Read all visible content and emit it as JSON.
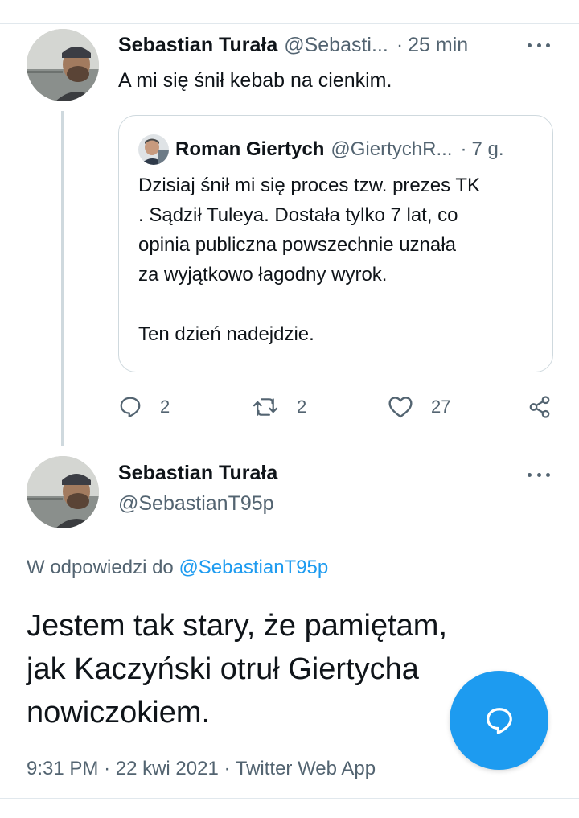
{
  "colors": {
    "accent": "#1d9bf0",
    "text_primary": "#0f1419",
    "text_secondary": "#536471",
    "border": "#cfd9de"
  },
  "tweet1": {
    "author_name": "Sebastian Turała",
    "author_handle": "@Sebasti...",
    "separator": "·",
    "time": "25 min",
    "text": "A mi się śnił kebab na cienkim.",
    "quoted": {
      "author_name": "Roman Giertych",
      "author_handle": "@GiertychR...",
      "separator": "·",
      "time": "7 g.",
      "text_lines": [
        "Dzisiaj śnił mi się proces tzw. prezes TK",
        ". Sądził Tuleya. Dostała tylko 7 lat, co",
        "opinia publiczna powszechnie uznała",
        "za wyjątkowo łagodny wyrok."
      ],
      "text_closing": "Ten dzień nadejdzie."
    },
    "actions": {
      "replies": "2",
      "retweets": "2",
      "likes": "27"
    }
  },
  "tweet2": {
    "author_name": "Sebastian Turała",
    "author_handle": "@SebastianT95p",
    "reply_to_prefix": "W odpowiedzi do",
    "reply_to_handle": "@SebastianT95p",
    "text_lines": [
      "Jestem tak stary, że pamiętam,",
      "jak Kaczyński otruł Giertycha",
      "nowiczokiem."
    ],
    "time": "9:31 PM",
    "separator": "·",
    "date": "22 kwi 2021",
    "source": "Twitter Web App"
  },
  "icons": {
    "more": "more-horizontal-icon",
    "reply": "reply-bubble-icon",
    "retweet": "retweet-icon",
    "like": "heart-icon",
    "share": "share-icon",
    "compose": "compose-reply-icon"
  }
}
